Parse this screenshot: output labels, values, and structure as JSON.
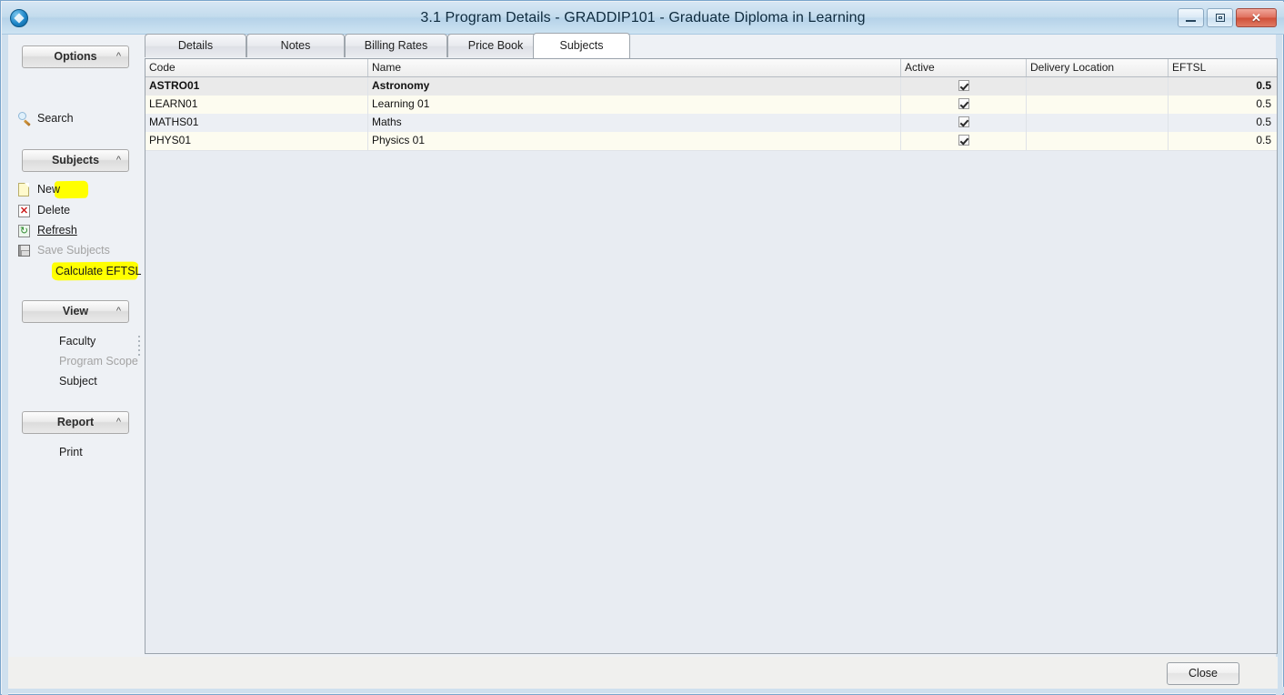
{
  "window": {
    "title": "3.1 Program Details - GRADDIP101 -  Graduate Diploma in Learning",
    "app_icon": "app-diamond-icon",
    "controls": {
      "minimize": "minimize-icon",
      "maximize": "restore-icon",
      "close": "✕"
    }
  },
  "sidebar": {
    "panels": [
      {
        "title": "Options",
        "chevron": "^",
        "items": [
          {
            "label": "Search",
            "icon": "magnifier-icon",
            "state": "normal"
          }
        ]
      },
      {
        "title": "Subjects",
        "chevron": "^",
        "items": [
          {
            "label": "New",
            "icon": "new-page-icon",
            "state": "highlighted"
          },
          {
            "label": "Delete",
            "icon": "delete-x-icon",
            "state": "normal"
          },
          {
            "label": "Refresh",
            "icon": "refresh-icon",
            "state": "link"
          },
          {
            "label": "Save Subjects",
            "icon": "save-floppy-icon",
            "state": "disabled"
          },
          {
            "label": "Calculate EFTSL",
            "icon": "none",
            "state": "highlighted"
          }
        ]
      },
      {
        "title": "View",
        "chevron": "^",
        "items": [
          {
            "label": "Faculty",
            "icon": "none",
            "state": "normal"
          },
          {
            "label": "Program Scope",
            "icon": "none",
            "state": "disabled"
          },
          {
            "label": "Subject",
            "icon": "none",
            "state": "normal"
          }
        ]
      },
      {
        "title": "Report",
        "chevron": "^",
        "items": [
          {
            "label": "Print",
            "icon": "none",
            "state": "normal"
          }
        ]
      }
    ]
  },
  "tabs": [
    {
      "label": "Details",
      "active": false
    },
    {
      "label": "Notes",
      "active": false
    },
    {
      "label": "Billing Rates",
      "active": false
    },
    {
      "label": "Price Book",
      "active": false
    },
    {
      "label": "Subjects",
      "active": true
    }
  ],
  "grid": {
    "columns": [
      {
        "label": "Code"
      },
      {
        "label": "Name"
      },
      {
        "label": "Active"
      },
      {
        "label": "Delivery Location"
      },
      {
        "label": "EFTSL"
      }
    ],
    "rows": [
      {
        "code": "ASTRO01",
        "name": "Astronomy",
        "active": true,
        "delivery_location": "",
        "eftsl": "0.5",
        "selected": true
      },
      {
        "code": "LEARN01",
        "name": "Learning 01",
        "active": true,
        "delivery_location": "",
        "eftsl": "0.5",
        "selected": false
      },
      {
        "code": "MATHS01",
        "name": "Maths",
        "active": true,
        "delivery_location": "",
        "eftsl": "0.5",
        "selected": false
      },
      {
        "code": "PHYS01",
        "name": "Physics 01",
        "active": true,
        "delivery_location": "",
        "eftsl": "0.5",
        "selected": false
      }
    ]
  },
  "footer": {
    "close_label": "Close"
  },
  "colors": {
    "highlight_marker": "#ffff00",
    "titlebar": "#c4dced",
    "close_button_red": "#cf4f38",
    "row_even": "#fdfcf0",
    "row_odd": "#eceff4",
    "row_selected": "#eaeaea"
  }
}
